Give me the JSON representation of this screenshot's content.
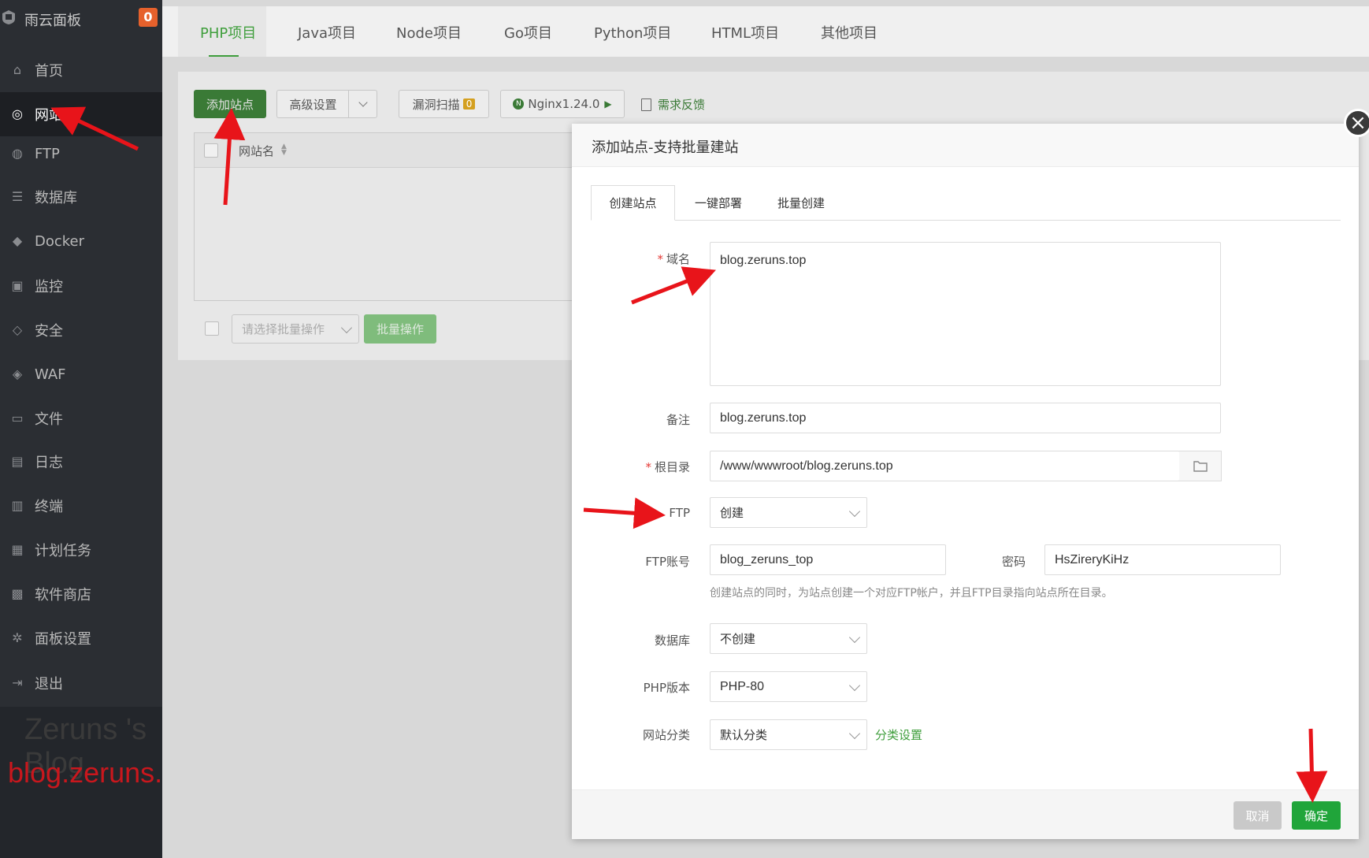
{
  "sidebar": {
    "brand": "雨云面板",
    "badge": "0",
    "items": [
      {
        "label": "首页",
        "icon": "home-icon"
      },
      {
        "label": "网站",
        "icon": "globe-icon"
      },
      {
        "label": "FTP",
        "icon": "ftp-icon"
      },
      {
        "label": "数据库",
        "icon": "database-icon"
      },
      {
        "label": "Docker",
        "icon": "docker-icon"
      },
      {
        "label": "监控",
        "icon": "monitor-icon"
      },
      {
        "label": "安全",
        "icon": "shield-icon"
      },
      {
        "label": "WAF",
        "icon": "waf-icon"
      },
      {
        "label": "文件",
        "icon": "folder-icon"
      },
      {
        "label": "日志",
        "icon": "log-icon"
      },
      {
        "label": "终端",
        "icon": "terminal-icon"
      },
      {
        "label": "计划任务",
        "icon": "calendar-icon"
      },
      {
        "label": "软件商店",
        "icon": "apps-icon"
      },
      {
        "label": "面板设置",
        "icon": "gear-icon"
      },
      {
        "label": "退出",
        "icon": "logout-icon"
      }
    ],
    "active_index": 1
  },
  "watermark": {
    "title": "Zeruns 's Blog",
    "url": "blog.zeruns.tech"
  },
  "tabs": [
    "PHP项目",
    "Java项目",
    "Node项目",
    "Go项目",
    "Python项目",
    "HTML项目",
    "其他项目"
  ],
  "toolbar": {
    "add_site": "添加站点",
    "advanced": "高级设置",
    "vuln_scan": "漏洞扫描",
    "vuln_count": "0",
    "nginx": "Nginx1.24.0",
    "feedback": "需求反馈"
  },
  "table": {
    "col_name": "网站名"
  },
  "batch": {
    "placeholder": "请选择批量操作",
    "button": "批量操作"
  },
  "modal": {
    "title": "添加站点-支持批量建站",
    "tabs": [
      "创建站点",
      "一键部署",
      "批量创建"
    ],
    "domain_label": "域名",
    "domain_value": "blog.zeruns.top",
    "remark_label": "备注",
    "remark_value": "blog.zeruns.top",
    "root_label": "根目录",
    "root_value": "/www/wwwroot/blog.zeruns.top",
    "ftp_label": "FTP",
    "ftp_value": "创建",
    "ftp_account_label": "FTP账号",
    "ftp_account_value": "blog_zeruns_top",
    "password_label": "密码",
    "password_value": "HsZireryKiHz",
    "ftp_hint": "创建站点的同时，为站点创建一个对应FTP帐户，并且FTP目录指向站点所在目录。",
    "db_label": "数据库",
    "db_value": "不创建",
    "php_label": "PHP版本",
    "php_value": "PHP-80",
    "category_label": "网站分类",
    "category_value": "默认分类",
    "category_link": "分类设置",
    "cancel": "取消",
    "confirm": "确定"
  },
  "colors": {
    "accent_green": "#20a53a",
    "sidebar_bg": "#2b2e33",
    "arrow_red": "#e8141a"
  }
}
